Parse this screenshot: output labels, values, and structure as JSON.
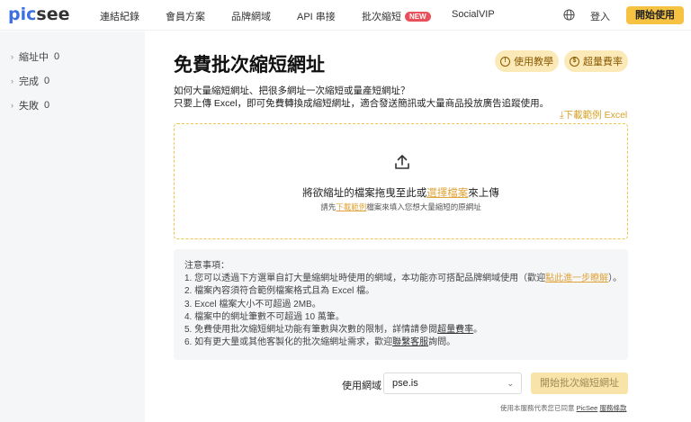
{
  "brand": {
    "logo_pic": "pic",
    "logo_see": "see"
  },
  "nav": {
    "items": [
      {
        "label": "連結紀錄"
      },
      {
        "label": "會員方案"
      },
      {
        "label": "品牌網域"
      },
      {
        "label": "API 串接"
      },
      {
        "label": "批次縮短",
        "badge": "NEW"
      },
      {
        "label": "SocialVIP"
      }
    ],
    "login": "登入",
    "start": "開始使用"
  },
  "sidebar": {
    "items": [
      {
        "label": "縮址中",
        "count": "0"
      },
      {
        "label": "完成",
        "count": "0"
      },
      {
        "label": "失敗",
        "count": "0"
      }
    ]
  },
  "main": {
    "title": "免費批次縮短網址",
    "tutorial_pill": "使用教學",
    "fee_pill": "超量費率",
    "desc_line1": "如何大量縮短網址、把很多網址一次縮短或量產短網址？",
    "desc_line2": "只要上傳 Excel，即可免費轉換成縮短網址，適合發送簡訊或大量商品投放廣告追蹤使用。",
    "download_sample": "下載範例 Excel"
  },
  "dropzone": {
    "main_before": "將欲縮址的檔案拖曳至此或",
    "main_link": "選擇檔案",
    "main_after": "來上傳",
    "sub_before": "請先",
    "sub_link": "下載範例",
    "sub_after": "檔案來填入您想大量縮短的原網址"
  },
  "notes": {
    "heading": "注意事項：",
    "line1_before": "1. 您可以透過下方選單自訂大量縮網址時使用的網域，本功能亦可搭配品牌網域使用（歡迎",
    "line1_link": "點此進一步瞭解",
    "line1_after": "）。",
    "line2": "2. 檔案內容須符合範例檔案格式且為 Excel 檔。",
    "line3": "3. Excel 檔案大小不可超過 2MB。",
    "line4": "4. 檔案中的網址筆數不可超過 10 萬筆。",
    "line5_before": "5. 免費使用批次縮短網址功能有筆數與次數的限制，詳情請參閱",
    "line5_link": "超量費率",
    "line5_after": "。",
    "line6_before": "6. 如有更大量或其他客製化的批次縮網址需求，歡迎",
    "line6_link": "聯繫客服",
    "line6_after": "詢問。"
  },
  "form": {
    "domain_label": "使用網域",
    "domain_value": "pse.is",
    "submit": "開始批次縮短網址"
  },
  "footer": {
    "before": "使用本服務代表您已同意 ",
    "brand": "PicSee",
    "terms": "服務條款"
  },
  "colors": {
    "accent_yellow": "#f5c242",
    "brand_blue": "#3e6fe0",
    "badge_red": "#e8505b",
    "link_gold": "#e0a43a"
  }
}
